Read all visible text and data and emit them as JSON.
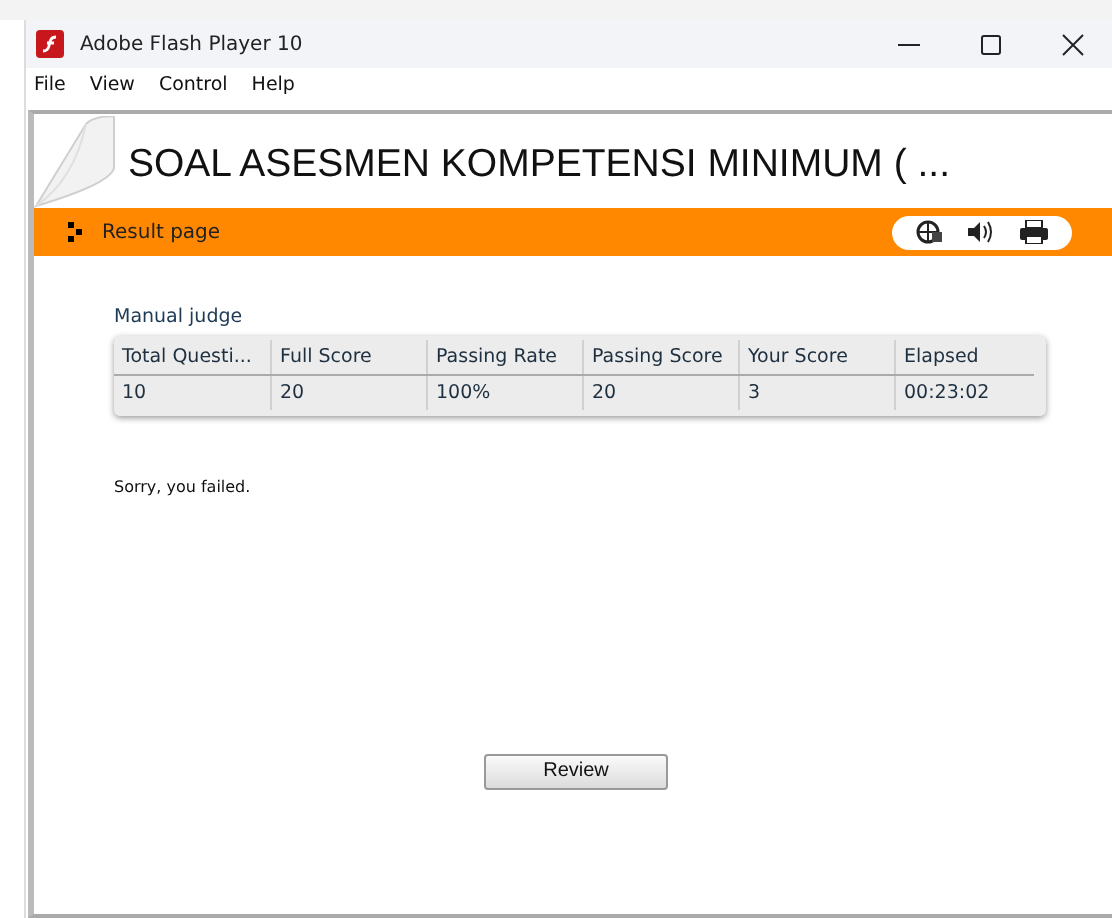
{
  "window": {
    "title": "Adobe Flash Player 10"
  },
  "menu": [
    "File",
    "View",
    "Control",
    "Help"
  ],
  "heading": "SOAL ASESMEN KOMPETENSI MINIMUM ( ...",
  "toolbar": {
    "title": "Result page"
  },
  "section_title": "Manual judge",
  "table": {
    "columns": [
      "Total Questi...",
      "Full Score",
      "Passing Rate",
      "Passing Score",
      "Your Score",
      "Elapsed"
    ],
    "rows": [
      [
        "10",
        "20",
        "100%",
        "20",
        "3",
        "00:23:02"
      ]
    ]
  },
  "message": "Sorry, you failed.",
  "buttons": [
    "Review"
  ]
}
